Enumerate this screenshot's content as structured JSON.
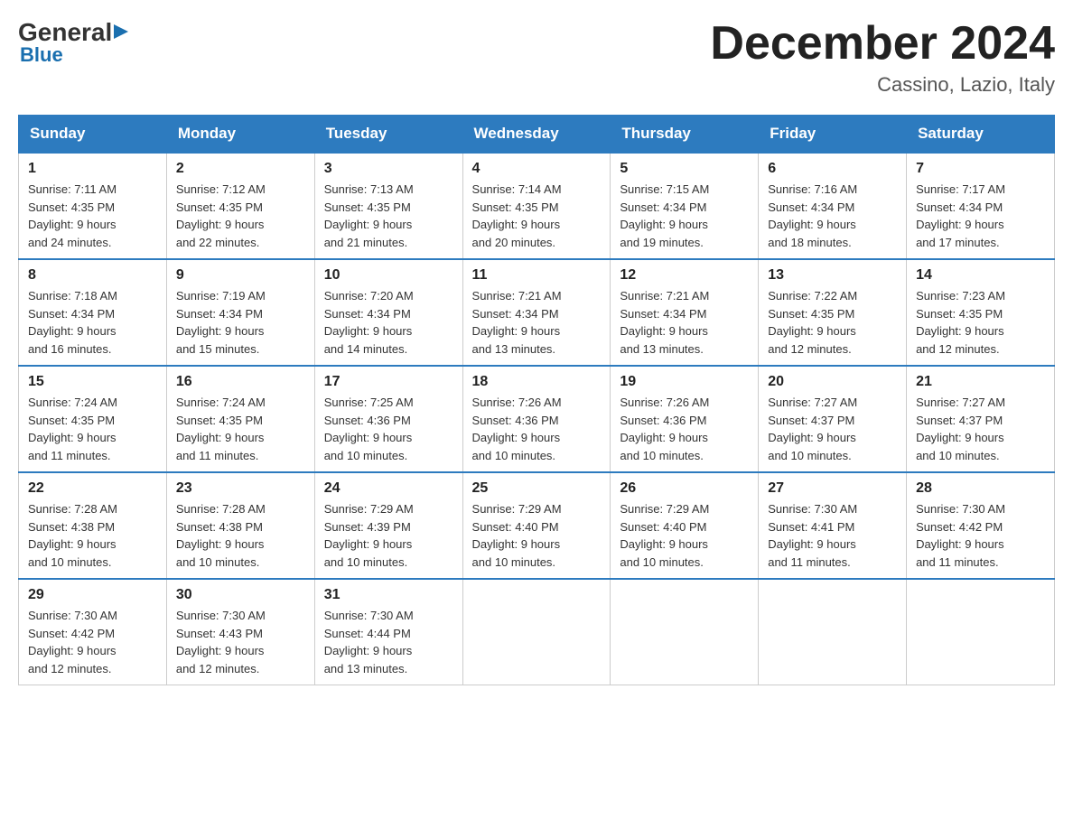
{
  "header": {
    "logo_general": "General",
    "logo_blue": "Blue",
    "month_title": "December 2024",
    "location": "Cassino, Lazio, Italy"
  },
  "weekdays": [
    "Sunday",
    "Monday",
    "Tuesday",
    "Wednesday",
    "Thursday",
    "Friday",
    "Saturday"
  ],
  "weeks": [
    [
      {
        "day": "1",
        "sunrise": "7:11 AM",
        "sunset": "4:35 PM",
        "daylight": "9 hours and 24 minutes."
      },
      {
        "day": "2",
        "sunrise": "7:12 AM",
        "sunset": "4:35 PM",
        "daylight": "9 hours and 22 minutes."
      },
      {
        "day": "3",
        "sunrise": "7:13 AM",
        "sunset": "4:35 PM",
        "daylight": "9 hours and 21 minutes."
      },
      {
        "day": "4",
        "sunrise": "7:14 AM",
        "sunset": "4:35 PM",
        "daylight": "9 hours and 20 minutes."
      },
      {
        "day": "5",
        "sunrise": "7:15 AM",
        "sunset": "4:34 PM",
        "daylight": "9 hours and 19 minutes."
      },
      {
        "day": "6",
        "sunrise": "7:16 AM",
        "sunset": "4:34 PM",
        "daylight": "9 hours and 18 minutes."
      },
      {
        "day": "7",
        "sunrise": "7:17 AM",
        "sunset": "4:34 PM",
        "daylight": "9 hours and 17 minutes."
      }
    ],
    [
      {
        "day": "8",
        "sunrise": "7:18 AM",
        "sunset": "4:34 PM",
        "daylight": "9 hours and 16 minutes."
      },
      {
        "day": "9",
        "sunrise": "7:19 AM",
        "sunset": "4:34 PM",
        "daylight": "9 hours and 15 minutes."
      },
      {
        "day": "10",
        "sunrise": "7:20 AM",
        "sunset": "4:34 PM",
        "daylight": "9 hours and 14 minutes."
      },
      {
        "day": "11",
        "sunrise": "7:21 AM",
        "sunset": "4:34 PM",
        "daylight": "9 hours and 13 minutes."
      },
      {
        "day": "12",
        "sunrise": "7:21 AM",
        "sunset": "4:34 PM",
        "daylight": "9 hours and 13 minutes."
      },
      {
        "day": "13",
        "sunrise": "7:22 AM",
        "sunset": "4:35 PM",
        "daylight": "9 hours and 12 minutes."
      },
      {
        "day": "14",
        "sunrise": "7:23 AM",
        "sunset": "4:35 PM",
        "daylight": "9 hours and 12 minutes."
      }
    ],
    [
      {
        "day": "15",
        "sunrise": "7:24 AM",
        "sunset": "4:35 PM",
        "daylight": "9 hours and 11 minutes."
      },
      {
        "day": "16",
        "sunrise": "7:24 AM",
        "sunset": "4:35 PM",
        "daylight": "9 hours and 11 minutes."
      },
      {
        "day": "17",
        "sunrise": "7:25 AM",
        "sunset": "4:36 PM",
        "daylight": "9 hours and 10 minutes."
      },
      {
        "day": "18",
        "sunrise": "7:26 AM",
        "sunset": "4:36 PM",
        "daylight": "9 hours and 10 minutes."
      },
      {
        "day": "19",
        "sunrise": "7:26 AM",
        "sunset": "4:36 PM",
        "daylight": "9 hours and 10 minutes."
      },
      {
        "day": "20",
        "sunrise": "7:27 AM",
        "sunset": "4:37 PM",
        "daylight": "9 hours and 10 minutes."
      },
      {
        "day": "21",
        "sunrise": "7:27 AM",
        "sunset": "4:37 PM",
        "daylight": "9 hours and 10 minutes."
      }
    ],
    [
      {
        "day": "22",
        "sunrise": "7:28 AM",
        "sunset": "4:38 PM",
        "daylight": "9 hours and 10 minutes."
      },
      {
        "day": "23",
        "sunrise": "7:28 AM",
        "sunset": "4:38 PM",
        "daylight": "9 hours and 10 minutes."
      },
      {
        "day": "24",
        "sunrise": "7:29 AM",
        "sunset": "4:39 PM",
        "daylight": "9 hours and 10 minutes."
      },
      {
        "day": "25",
        "sunrise": "7:29 AM",
        "sunset": "4:40 PM",
        "daylight": "9 hours and 10 minutes."
      },
      {
        "day": "26",
        "sunrise": "7:29 AM",
        "sunset": "4:40 PM",
        "daylight": "9 hours and 10 minutes."
      },
      {
        "day": "27",
        "sunrise": "7:30 AM",
        "sunset": "4:41 PM",
        "daylight": "9 hours and 11 minutes."
      },
      {
        "day": "28",
        "sunrise": "7:30 AM",
        "sunset": "4:42 PM",
        "daylight": "9 hours and 11 minutes."
      }
    ],
    [
      {
        "day": "29",
        "sunrise": "7:30 AM",
        "sunset": "4:42 PM",
        "daylight": "9 hours and 12 minutes."
      },
      {
        "day": "30",
        "sunrise": "7:30 AM",
        "sunset": "4:43 PM",
        "daylight": "9 hours and 12 minutes."
      },
      {
        "day": "31",
        "sunrise": "7:30 AM",
        "sunset": "4:44 PM",
        "daylight": "9 hours and 13 minutes."
      },
      null,
      null,
      null,
      null
    ]
  ],
  "labels": {
    "sunrise": "Sunrise:",
    "sunset": "Sunset:",
    "daylight": "Daylight:"
  }
}
